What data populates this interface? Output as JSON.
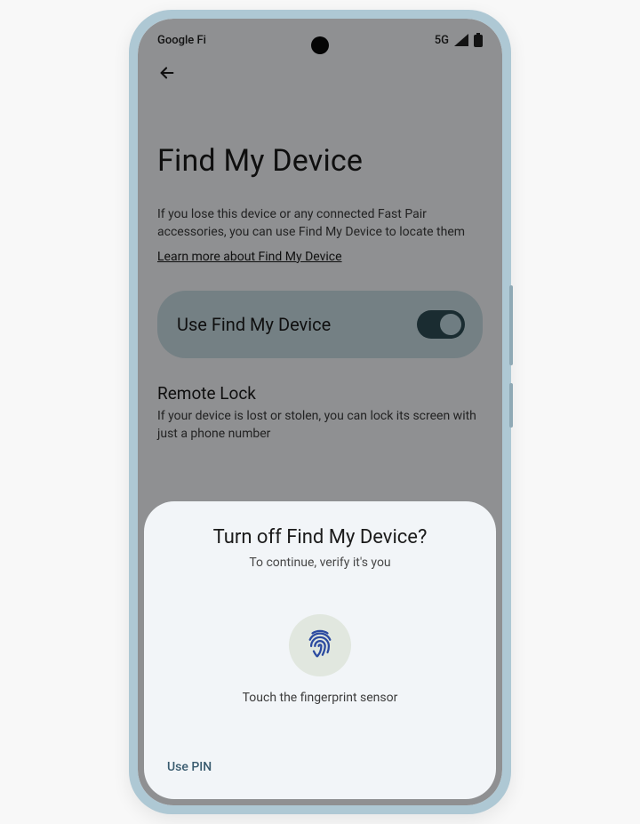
{
  "statusbar": {
    "carrier": "Google Fi",
    "network": "5G"
  },
  "page": {
    "title": "Find My Device",
    "description": "If you lose this device or any connected Fast Pair accessories, you can use Find My Device to locate them",
    "learn_link": "Learn more about Find My Device"
  },
  "toggle": {
    "label": "Use Find My Device",
    "state": true
  },
  "remote_lock": {
    "title": "Remote Lock",
    "description": "If your device is lost or stolen, you can lock its screen with just a phone number"
  },
  "sheet": {
    "title": "Turn off Find My Device?",
    "subtitle": "To continue, verify it's you",
    "touch_hint": "Touch the fingerprint sensor",
    "use_pin": "Use PIN"
  },
  "icons": {
    "back": "back-arrow-icon",
    "signal": "signal-icon",
    "battery": "battery-icon",
    "fingerprint": "fingerprint-icon"
  }
}
